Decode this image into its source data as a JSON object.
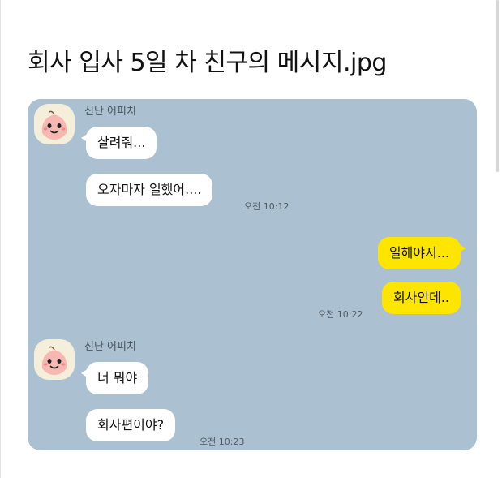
{
  "post": {
    "title": "회사 입사 5일 차 친구의 메시지.jpg"
  },
  "chat": {
    "colors": {
      "background": "#abc1d1",
      "incoming_bubble": "#ffffff",
      "outgoing_bubble": "#fee500"
    },
    "groups": [
      {
        "sender": "신난 어피치",
        "avatar_icon": "apeach-avatar-icon",
        "messages": [
          "살려줘...",
          "오자마자 일했어...."
        ],
        "time": "오전 10:12"
      },
      {
        "sender": "me",
        "messages": [
          "일해야지...",
          "회사인데.."
        ],
        "time": "오전 10:22"
      },
      {
        "sender": "신난 어피치",
        "avatar_icon": "apeach-avatar-icon",
        "messages": [
          "너 뭐야",
          "회사편이야?"
        ],
        "time": "오전 10:23"
      }
    ]
  }
}
